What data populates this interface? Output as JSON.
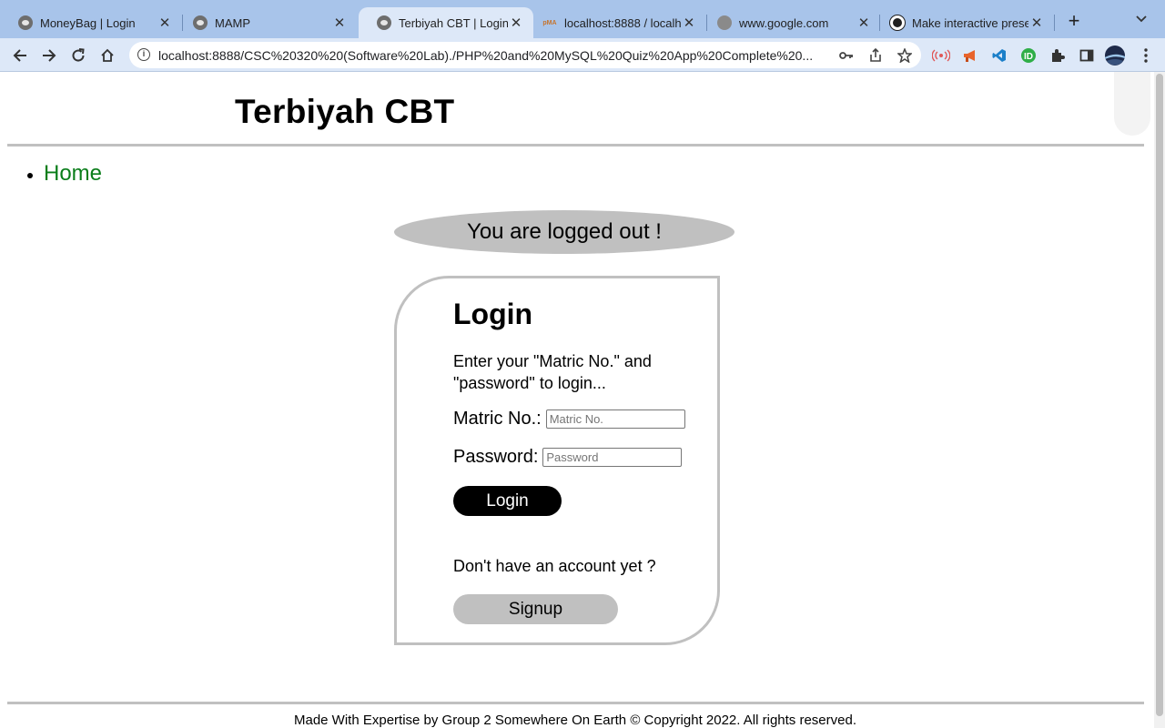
{
  "browser": {
    "tabs": [
      {
        "title": "MoneyBag | Login",
        "icon": "pig-favicon",
        "active": false
      },
      {
        "title": "MAMP",
        "icon": "pig-favicon",
        "active": false
      },
      {
        "title": "Terbiyah CBT | Login",
        "icon": "pig-favicon",
        "active": true
      },
      {
        "title": "localhost:8888 / localh",
        "icon": "phpmyadmin-favicon",
        "active": false
      },
      {
        "title": "www.google.com",
        "icon": "globe-favicon",
        "active": false
      },
      {
        "title": "Make interactive prese",
        "icon": "canva-favicon",
        "active": false
      }
    ],
    "pma_favicon_text": "pMA",
    "url": "localhost:8888/CSC%20320%20(Software%20Lab)./PHP%20and%20MySQL%20Quiz%20App%20Complete%20...",
    "accent_color": "#a8c4ea"
  },
  "site": {
    "title": "Terbiyah CBT",
    "nav": [
      {
        "label": "Home"
      }
    ],
    "logout_message": "You are logged out !",
    "login": {
      "heading": "Login",
      "description": "Enter your \"Matric No.\" and \"password\" to login...",
      "matric_label": "Matric No.:",
      "matric_placeholder": "Matric No.",
      "matric_value": "",
      "password_label": "Password:",
      "password_placeholder": "Password",
      "password_value": "",
      "login_button": "Login",
      "no_account_text": "Don't have an account yet ?",
      "signup_button": "Signup"
    },
    "footer": "Made With Expertise by Group 2 Somewhere On Earth © Copyright 2022. All rights reserved.",
    "link_color": "#0a7d1a",
    "panel_grey": "#c0c0c0"
  }
}
